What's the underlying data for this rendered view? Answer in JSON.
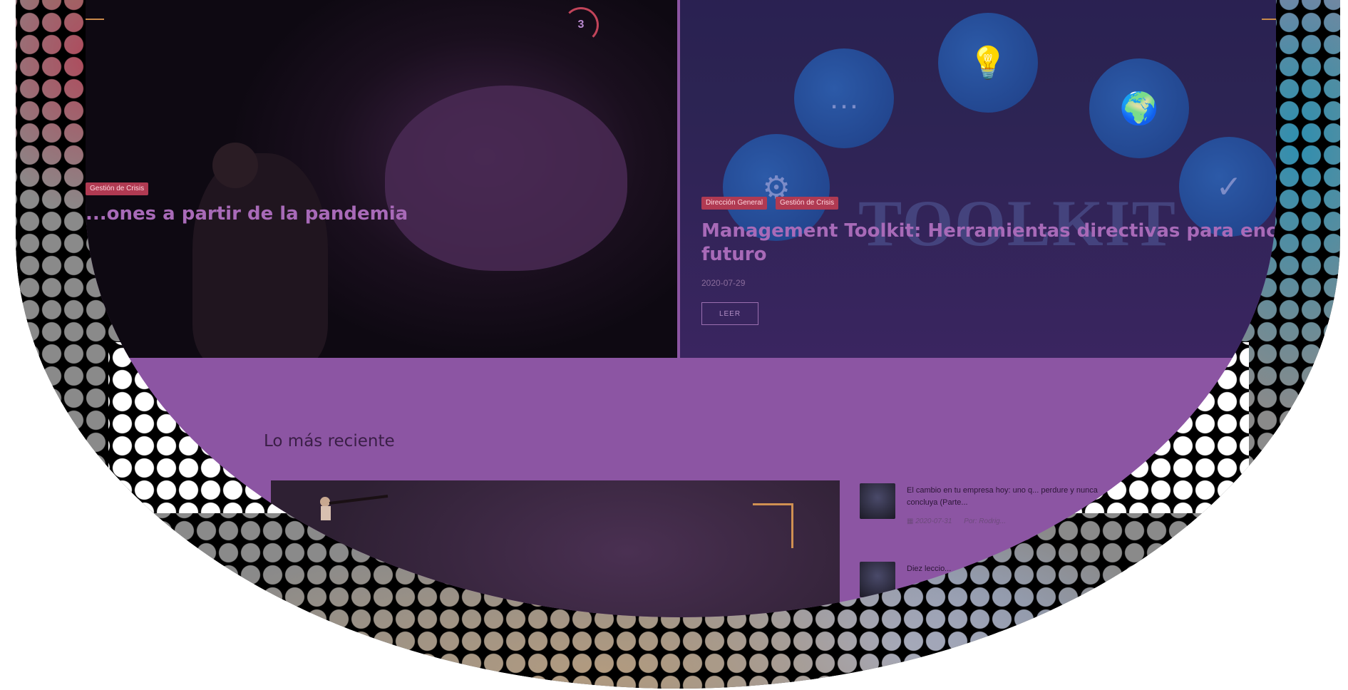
{
  "hero_left": {
    "category": "Gestión de Crisis",
    "title": "...ones a partir de la pandemia",
    "slide_counter": "3"
  },
  "hero_right": {
    "categories": [
      "Dirección General",
      "Gestión de Crisis"
    ],
    "background_word": "TOOLKIT",
    "title_line1": "Management Toolkit: Herramientas directivas para enca",
    "title_line2": "futuro",
    "date": "2020-07-29",
    "read_label": "LEER"
  },
  "recent": {
    "title": "Lo más reciente",
    "items": [
      {
        "title": "El cambio en tu empresa hoy: uno q... perdure y nunca concluya (Parte...",
        "date": "2020-07-31",
        "author": "Por: Rodrig..."
      },
      {
        "title": "Diez leccio...",
        "date": "",
        "author": ""
      }
    ]
  },
  "icons": [
    "chat-icon",
    "lightbulb-icon",
    "globe-icon",
    "gear-icon",
    "checklist-icon",
    "calendar-icon"
  ],
  "colors": {
    "page_bg": "#8c55a3",
    "tag_red": "#b03a52",
    "hero_title": "#a86ab8",
    "accent_orange": "#d09052"
  }
}
